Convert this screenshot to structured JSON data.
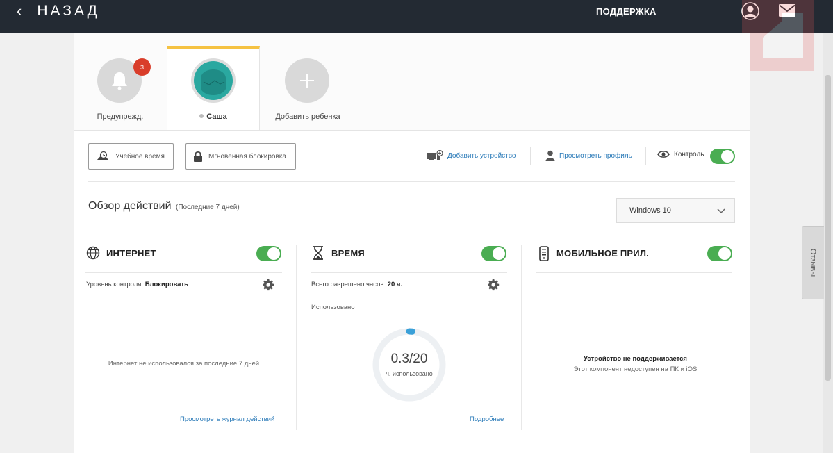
{
  "header": {
    "back_label": "НАЗАД",
    "support_label": "ПОДДЕРЖКА",
    "icons": [
      "chevron-left-icon",
      "account-icon",
      "mail-icon"
    ]
  },
  "tabs": [
    {
      "label": "Предупрежд.",
      "badge": "3",
      "icon": "bell-icon"
    },
    {
      "label": "Саша",
      "active": true,
      "icon": "avatar"
    },
    {
      "label": "Добавить ребенка",
      "icon": "plus-icon"
    }
  ],
  "actions": {
    "study_time": "Учебное время",
    "instant_block": "Мгновенная блокировка",
    "add_device": "Добавить устройство",
    "view_profile": "Просмотреть профиль",
    "control": "Контроль",
    "control_on": true
  },
  "overview": {
    "title": "Обзор действий",
    "period": "(Последние 7 дней)",
    "device": "Windows 10"
  },
  "internet": {
    "title": "ИНТЕРНЕТ",
    "enabled": true,
    "level_label": "Уровень контроля:",
    "level_value": "Блокировать",
    "empty_text": "Интернет не использовался за последние 7 дней",
    "link": "Просмотреть журнал действий"
  },
  "time": {
    "title": "ВРЕМЯ",
    "enabled": true,
    "allowed_label": "Всего разрешено часов:",
    "allowed_value": "20 ч.",
    "used_label": "Использовано",
    "used_display": "0.3/20",
    "used_hours": 0.3,
    "total_hours": 20,
    "unit_text": "ч. использовано",
    "link": "Подробнее"
  },
  "mobile": {
    "title": "МОБИЛЬНОЕ ПРИЛ.",
    "enabled": true,
    "unsupported_title": "Устройство не поддерживается",
    "unsupported_text": "Этот компонент недоступен на ПК и iOS"
  },
  "feedback_tab": "Отзывы",
  "colors": {
    "topbar": "#232a33",
    "accent_tab": "#f5c242",
    "toggle_on": "#4aad52",
    "link": "#2a7ab8",
    "badge": "#d93d2a",
    "ring_progress": "#3aa0d8",
    "avatar": "#2aa8a0"
  }
}
